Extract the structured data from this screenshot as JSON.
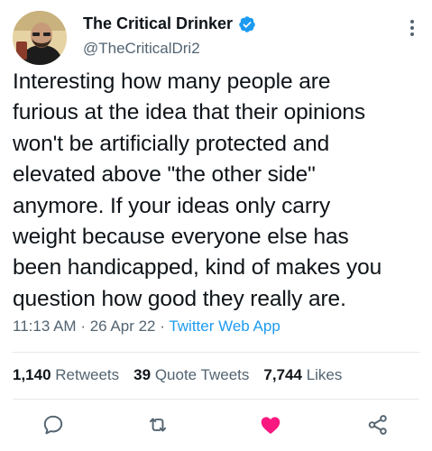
{
  "author": {
    "display_name": "The Critical Drinker",
    "handle": "@TheCriticalDri2",
    "verified": true
  },
  "tweet": {
    "lines": [
      "Interesting how many people are",
      "furious at the idea that their opinions",
      "won't be artificially protected and",
      "elevated above \"the other side\"",
      "anymore. If your ideas only carry",
      "weight because everyone else has",
      "been handicapped, kind of makes you",
      "question how good they really are."
    ],
    "time": "11:13 AM",
    "date": "26 Apr 22",
    "source": "Twitter Web App",
    "separator": "·"
  },
  "stats": {
    "retweets_count": "1,140",
    "retweets_label": "Retweets",
    "quotes_count": "39",
    "quotes_label": "Quote Tweets",
    "likes_count": "7,744",
    "likes_label": "Likes"
  },
  "actions": {
    "reply_icon": "reply-icon",
    "retweet_icon": "retweet-icon",
    "like_icon": "heart-icon",
    "share_icon": "share-icon",
    "liked": true
  },
  "colors": {
    "accent": "#1d9bf0",
    "like": "#f91880",
    "secondary_text": "#536471",
    "primary_text": "#0f1419"
  }
}
